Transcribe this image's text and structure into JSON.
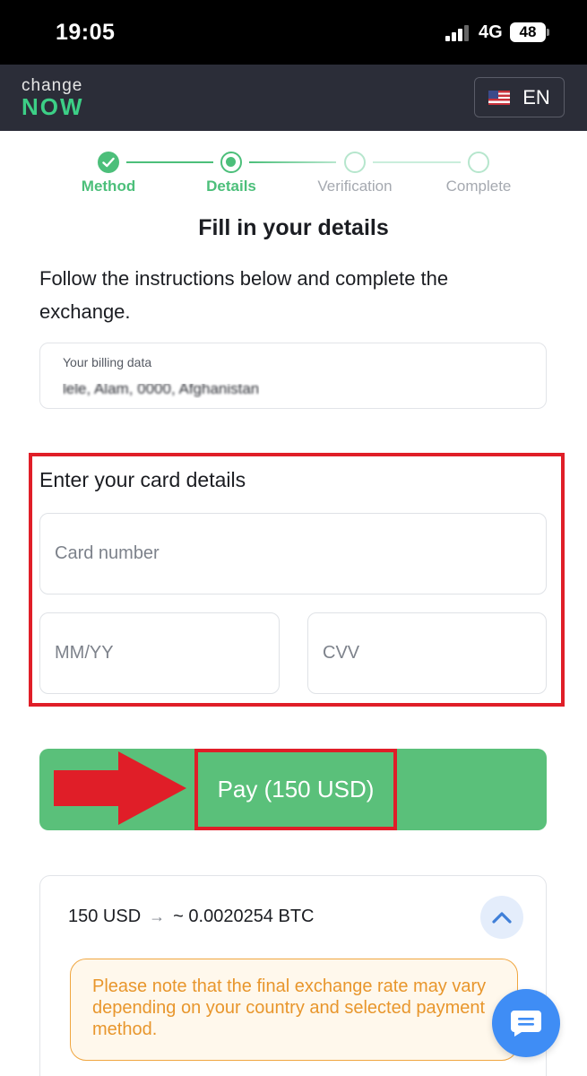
{
  "status_bar": {
    "time": "19:05",
    "network": "4G",
    "battery": "48"
  },
  "header": {
    "logo_top": "change",
    "logo_bottom": "NOW",
    "language": "EN"
  },
  "stepper": {
    "steps": [
      "Method",
      "Details",
      "Verification",
      "Complete"
    ],
    "current": "Details"
  },
  "page": {
    "title": "Fill in your details",
    "instructions": "Follow the instructions below and complete the exchange."
  },
  "billing": {
    "label": "Your billing data",
    "value": "lele, Alam, 0000, Afghanistan"
  },
  "card": {
    "title": "Enter your card details",
    "number_placeholder": "Card number",
    "expiry_placeholder": "MM/YY",
    "cvv_placeholder": "CVV"
  },
  "pay": {
    "label": "Pay (150 USD)"
  },
  "summary": {
    "from": "150 USD",
    "to": "~ 0.0020254 BTC",
    "notice": "Please note that the final exchange rate may vary depending on your country and selected payment method."
  },
  "colors": {
    "accent": "#4cbf7a",
    "header_bg": "#2b2d38",
    "highlight": "#e01e28",
    "notice": "#e8962c",
    "chat": "#3f8df5"
  },
  "icons": [
    "signal-icon",
    "battery-icon",
    "us-flag-icon",
    "check-icon",
    "arrow-right-icon",
    "chevron-up-icon",
    "chat-icon"
  ]
}
